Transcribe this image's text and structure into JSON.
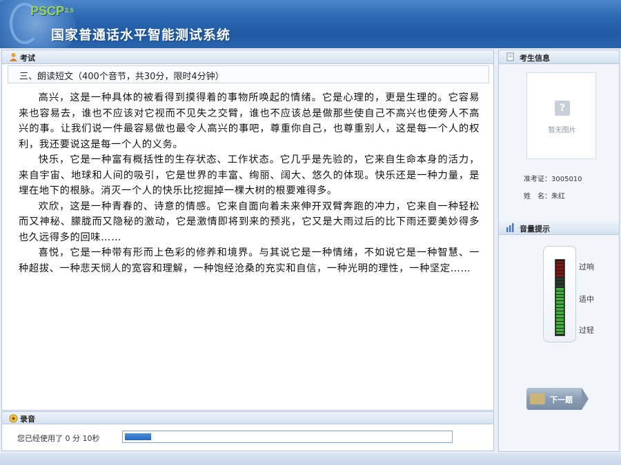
{
  "header": {
    "logo_text": "PSCP",
    "logo_version": "2.5",
    "app_title": "国家普通话水平智能测试系统"
  },
  "exam_panel": {
    "title": "考试",
    "section_title": "三、朗读短文（400个音节，共30分，限时4分钟）",
    "paragraphs": [
      "高兴，这是一种具体的被看得到摸得着的事物所唤起的情绪。它是心理的，更是生理的。它容易来也容易去，谁也不应该对它视而不见失之交臂，谁也不应该总是做那些使自己不高兴也使旁人不高兴的事。让我们说一件最容易做也最令人高兴的事吧，尊重你自己，也尊重别人，这是每一个人的权利，我还要说这是每一个人的义务。",
      "快乐，它是一种富有概括性的生存状态、工作状态。它几乎是先验的，它来自生命本身的活力，来自宇宙、地球和人间的吸引，它是世界的丰富、绚丽、阔大、悠久的体现。快乐还是一种力量，是埋在地下的根脉。消灭一个人的快乐比挖掘掉一棵大树的根要难得多。",
      "欢欣，这是一种青春的、诗意的情感。它来自面向着未来伸开双臂奔跑的冲力，它来自一种轻松而又神秘、朦胧而又隐秘的激动，它是激情即将到来的预兆，它又是大雨过后的比下雨还要美妙得多也久远得多的回味……",
      "喜悦，它是一种带有形而上色彩的修养和境界。与其说它是一种情绪，不如说它是一种智慧、一种超拔、一种悲天悯人的宽容和理解，一种饱经沧桑的充实和自信，一种光明的理性，一种坚定……"
    ]
  },
  "record_panel": {
    "title": "录音",
    "elapsed_text": "您已经使用了 0  分 10秒",
    "progress_fraction": 0.08
  },
  "candidate_panel": {
    "title": "考生信息",
    "photo_placeholder": "暂无图片",
    "exam_no_label": "准考证：",
    "exam_no_value": "3005010",
    "name_label": "姓　名：",
    "name_value": "朱红"
  },
  "volume_panel": {
    "title": "音量提示",
    "label_high": "过响",
    "label_mid": "适中",
    "label_low": "过轻",
    "level_fraction": 0.62
  },
  "next_button": {
    "label": "下一题"
  },
  "colors": {
    "header_blue": "#2e6ab3",
    "progress_blue": "#2167c0",
    "meter_green": "#3fae3a",
    "meter_red": "#7a1a12"
  }
}
